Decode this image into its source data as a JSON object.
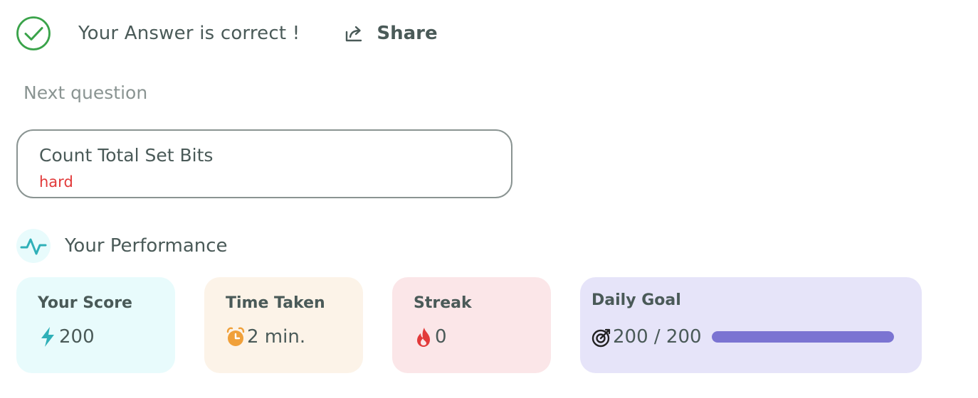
{
  "result": {
    "message": "Your Answer is correct !",
    "icon": "check-circle-icon",
    "color": "#3aa34a"
  },
  "share": {
    "label": "Share",
    "icon": "share-icon"
  },
  "next_question": {
    "section_label": "Next question",
    "title": "Count Total Set Bits",
    "difficulty": "hard",
    "difficulty_color": "#e23a3a"
  },
  "performance": {
    "title": "Your Performance",
    "icon": "pulse-icon",
    "icon_color": "#2fb0b8",
    "cards": {
      "score": {
        "label": "Your Score",
        "value": "200",
        "icon": "lightning-icon",
        "color": "#2fb0b8",
        "background": "#e8fbfc"
      },
      "time": {
        "label": "Time Taken",
        "value": "2 min.",
        "icon": "alarm-clock-icon",
        "color": "#f0a03a",
        "background": "#fcf3e8"
      },
      "streak": {
        "label": "Streak",
        "value": "0",
        "icon": "fire-icon",
        "color": "#e23a3a",
        "background": "#fbe6e8"
      },
      "goal": {
        "label": "Daily Goal",
        "value": "200 / 200",
        "icon": "target-icon",
        "progress": 1.0,
        "bar_color": "#7b74d2",
        "background": "#e6e4f9"
      }
    }
  }
}
